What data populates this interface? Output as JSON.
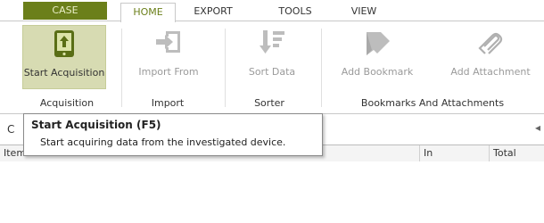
{
  "tabs": {
    "case": "CASE",
    "home": "HOME",
    "export": "EXPORT",
    "tools": "TOOLS",
    "view": "VIEW"
  },
  "ribbon": {
    "buttons": {
      "start_acquisition": "Start Acquisition",
      "import_from": "Import From",
      "sort_data": "Sort Data",
      "add_bookmark": "Add Bookmark",
      "add_attachment": "Add Attachment"
    },
    "groups": {
      "acquisition": "Acquisition",
      "import": "Import",
      "sorter": "Sorter",
      "bookmarks": "Bookmarks And Attachments"
    }
  },
  "tooltip": {
    "title": "Start Acquisition (F5)",
    "description": "Start acquiring data from the investigated device."
  },
  "panel": {
    "header_letter": "C",
    "scroll_arrow": "◂"
  },
  "grid": {
    "columns": [
      "Items",
      "In",
      "Total"
    ]
  },
  "colors": {
    "accent": "#6b7f1a",
    "active_button": "#d7dbb2",
    "disabled_text": "#9a9a9a"
  },
  "icons": {
    "start_acquisition": "device-upload-icon",
    "import_from": "import-arrow-icon",
    "sort_data": "sort-icon",
    "add_bookmark": "bookmark-icon",
    "add_attachment": "paperclip-icon"
  }
}
